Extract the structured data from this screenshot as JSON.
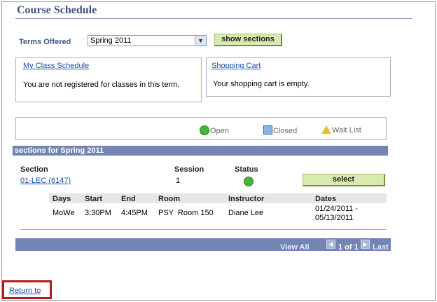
{
  "page": {
    "title": "Course Schedule"
  },
  "terms": {
    "label": "Terms Offered",
    "selected": "Spring 2011",
    "button": "show sections"
  },
  "class_schedule": {
    "link": "My Class Schedule",
    "message": "You are not registered for classes in this term."
  },
  "cart": {
    "link": "Shopping Cart",
    "message": "Your shopping cart is empty."
  },
  "legend": {
    "open": "Open",
    "closed": "Closed",
    "wait": "Wait List"
  },
  "sections": {
    "header": "sections for Spring 2011",
    "col_section": "Section",
    "col_session": "Session",
    "col_status": "Status",
    "row": {
      "section": "01-LEC (6147)",
      "session": "1",
      "status": "Open",
      "select": "select"
    },
    "meeting": {
      "headers": {
        "days": "Days",
        "start": "Start",
        "end": "End",
        "room": "Room",
        "instructor": "Instructor",
        "dates": "Dates"
      },
      "days": "MoWe",
      "start": "3:30PM",
      "end": "4:45PM",
      "room": "PSY  Room 150",
      "instructor": "Diane Lee",
      "dates_start": "01/24/2011 -",
      "dates_end": "05/13/2011"
    }
  },
  "footer": {
    "view_all": "View All",
    "count": "1 of 1",
    "last": "Last"
  },
  "return_link": "Return to",
  "colors": {
    "title": "#3e5680",
    "bar": "#7385b4",
    "button": "#d9eab0",
    "open": "#46b43c",
    "highlight": "#b01c1c"
  }
}
